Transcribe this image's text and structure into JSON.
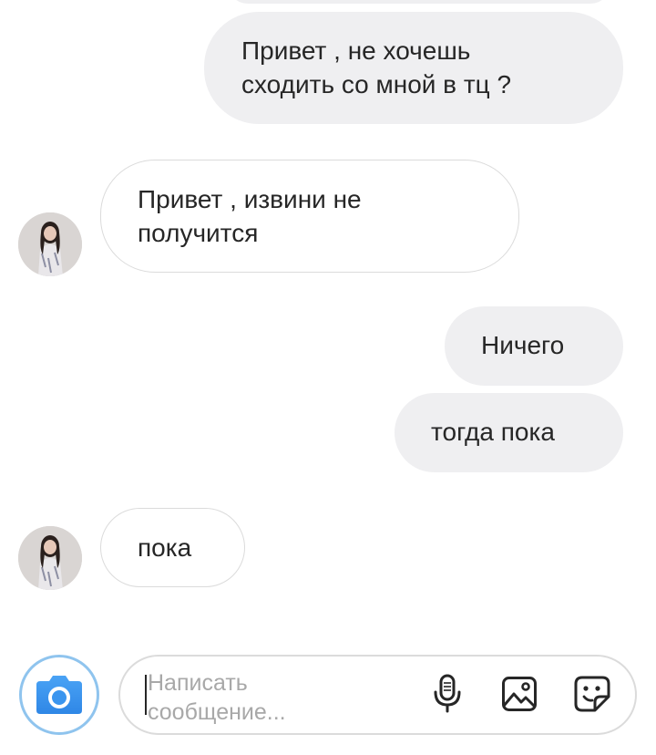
{
  "chat": {
    "messages": [
      {
        "id": "m1",
        "direction": "outgoing",
        "text": "Привет , не хочешь\nсходить со мной в тц ?"
      },
      {
        "id": "m2",
        "direction": "incoming",
        "text": "Привет , извини не\nполучится"
      },
      {
        "id": "m3",
        "direction": "outgoing",
        "text": "Ничего"
      },
      {
        "id": "m4",
        "direction": "outgoing",
        "text": "тогда пока"
      },
      {
        "id": "m5",
        "direction": "incoming",
        "text": "пока"
      }
    ]
  },
  "composer": {
    "placeholder": "Написать\nсообщение..."
  },
  "icons": {
    "camera": "camera-icon",
    "microphone": "microphone-icon",
    "gallery": "gallery-icon",
    "sticker": "sticker-icon"
  },
  "colors": {
    "outgoing_bubble": "#efeff1",
    "incoming_border": "#dbdbdb",
    "accent_blue": "#3897f0",
    "text": "#262626",
    "placeholder": "#a8a8a8"
  }
}
